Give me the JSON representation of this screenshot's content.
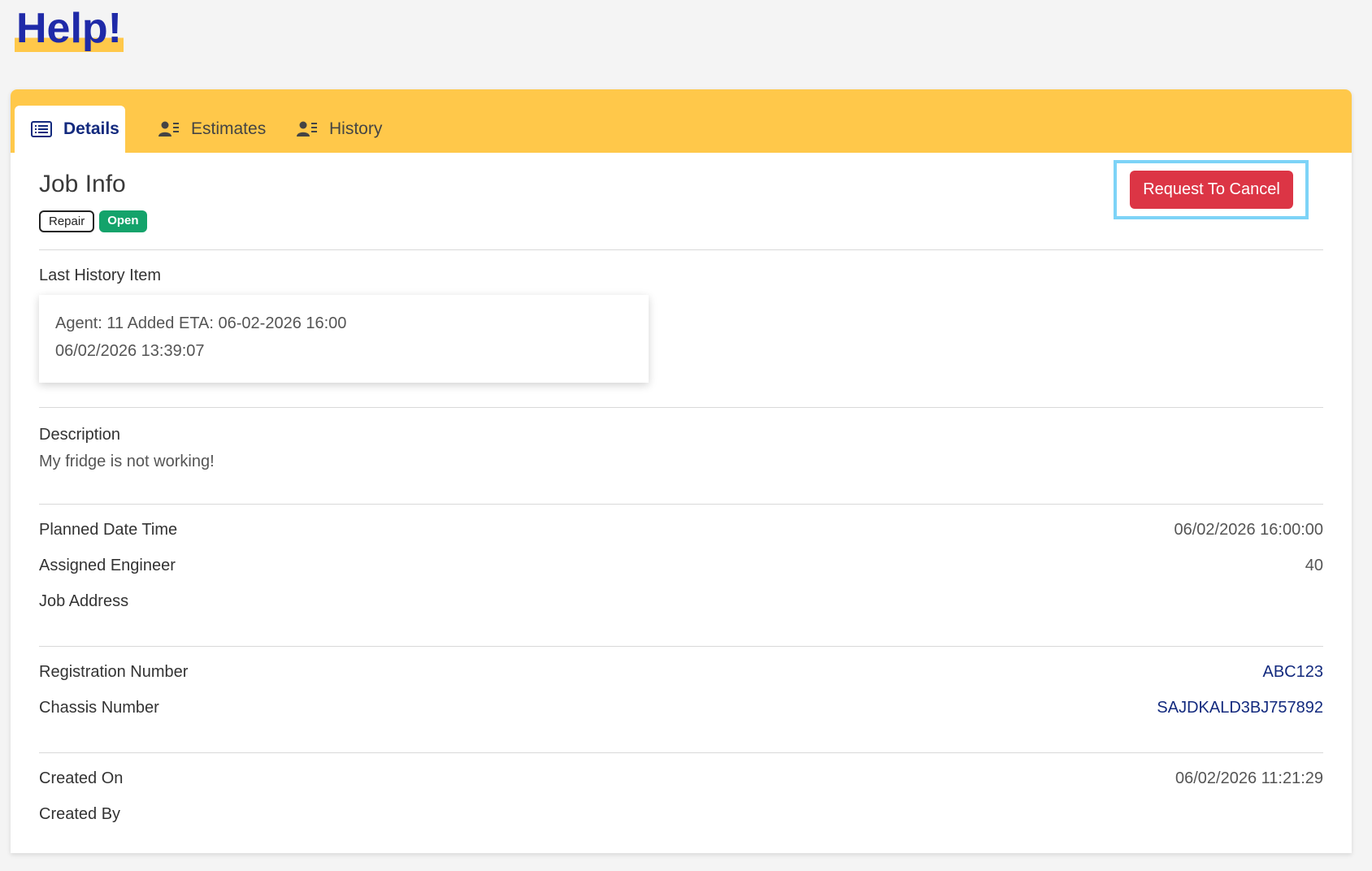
{
  "brand": {
    "logo_text": "Help!"
  },
  "tabs": [
    {
      "label": "Details",
      "icon": "list-icon",
      "active": true
    },
    {
      "label": "Estimates",
      "icon": "user-list-icon",
      "active": false
    },
    {
      "label": "History",
      "icon": "user-list-icon",
      "active": false
    }
  ],
  "job": {
    "title": "Job Info",
    "badges": {
      "type": "Repair",
      "status": "Open"
    },
    "cancel_label": "Request To Cancel"
  },
  "history": {
    "label": "Last History Item",
    "entry_text": "Agent: 11 Added ETA: 06-02-2026 16:00",
    "entry_time": "06/02/2026 13:39:07"
  },
  "description": {
    "label": "Description",
    "text": "My fridge is not working!"
  },
  "schedule": [
    {
      "label": "Planned Date Time",
      "value": "06/02/2026 16:00:00"
    },
    {
      "label": "Assigned Engineer",
      "value": "40"
    },
    {
      "label": "Job Address",
      "value": ""
    }
  ],
  "vehicle": [
    {
      "label": "Registration Number",
      "value": "ABC123"
    },
    {
      "label": "Chassis Number",
      "value": "SAJDKALD3BJ757892"
    }
  ],
  "created": [
    {
      "label": "Created On",
      "value": "06/02/2026 11:21:29"
    },
    {
      "label": "Created By",
      "value": ""
    }
  ],
  "colors": {
    "accent": "#ffc84a",
    "brand_text": "#1f2aa8",
    "danger": "#dc3545",
    "success": "#14a36b",
    "link": "#132a7e"
  }
}
